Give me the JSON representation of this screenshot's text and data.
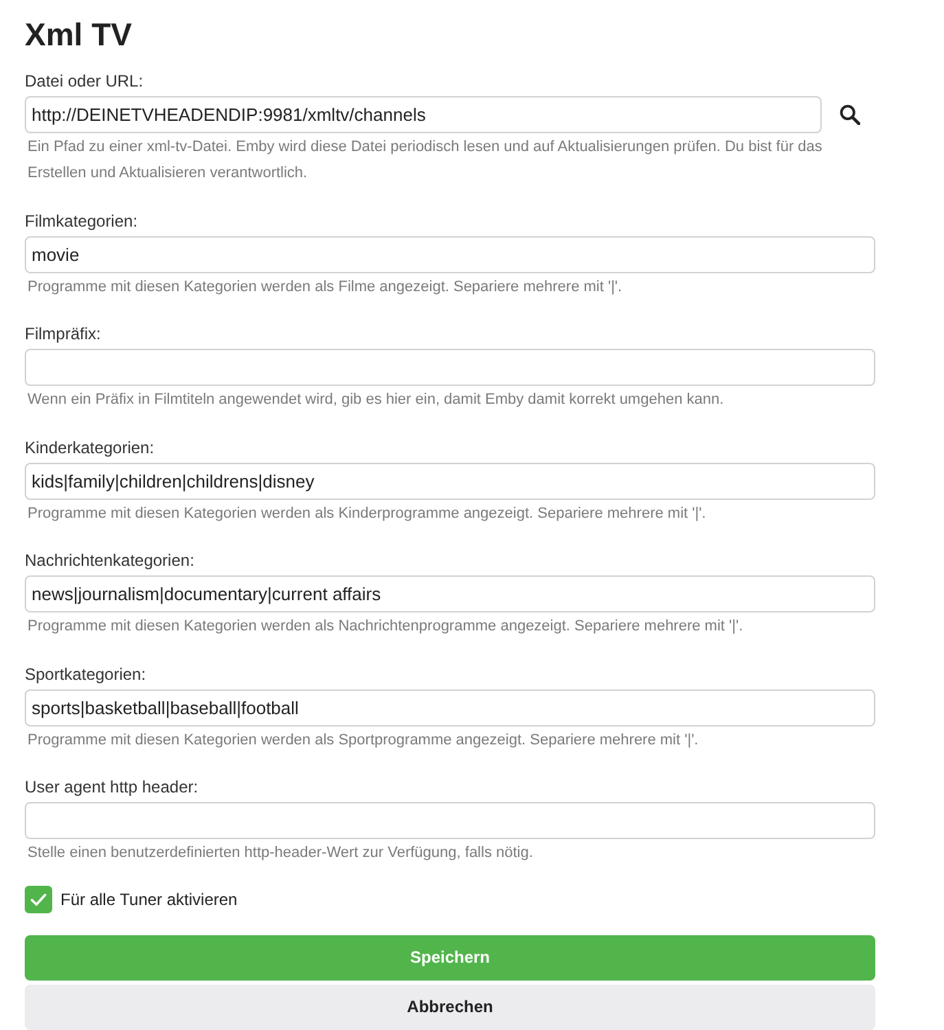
{
  "title": "Xml TV",
  "fields": [
    {
      "kind": "path",
      "label": "Datei oder URL:",
      "value": "http://DEINETVHEADENDIP:9981/xmltv/channels",
      "help": "Ein Pfad zu einer xml-tv-Datei. Emby wird diese Datei periodisch lesen und auf Aktualisierungen prüfen. Du bist für das Erstellen und Aktualisieren verantwortlich."
    },
    {
      "kind": "text",
      "label": "Filmkategorien:",
      "value": "movie",
      "help": "Programme mit diesen Kategorien werden als Filme angezeigt. Separiere mehrere mit '|'."
    },
    {
      "kind": "text",
      "label": "Filmpräfix:",
      "help": "Wenn ein Präfix in Filmtiteln angewendet wird, gib es hier ein, damit Emby damit korrekt umgehen kann."
    },
    {
      "kind": "text",
      "label": "Kinderkategorien:",
      "value": "kids|family|children|childrens|disney",
      "help": "Programme mit diesen Kategorien werden als Kinderprogramme angezeigt. Separiere mehrere mit '|'."
    },
    {
      "kind": "text",
      "label": "Nachrichtenkategorien:",
      "value": "news|journalism|documentary|current affairs",
      "help": "Programme mit diesen Kategorien werden als Nachrichtenprogramme angezeigt. Separiere mehrere mit '|'."
    },
    {
      "kind": "text",
      "label": "Sportkategorien:",
      "value": "sports|basketball|baseball|football",
      "help": "Programme mit diesen Kategorien werden als Sportprogramme angezeigt. Separiere mehrere mit '|'."
    },
    {
      "kind": "text",
      "label": "User agent http header:",
      "help": "Stelle einen benutzerdefinierten http-header-Wert zur Verfügung, falls nötig."
    }
  ],
  "checkbox": {
    "label": "Für alle Tuner aktivieren",
    "checked": true
  },
  "buttons": [
    {
      "kind": "primary",
      "label": "Speichern"
    },
    {
      "kind": "secondary",
      "label": "Abbrechen"
    }
  ]
}
